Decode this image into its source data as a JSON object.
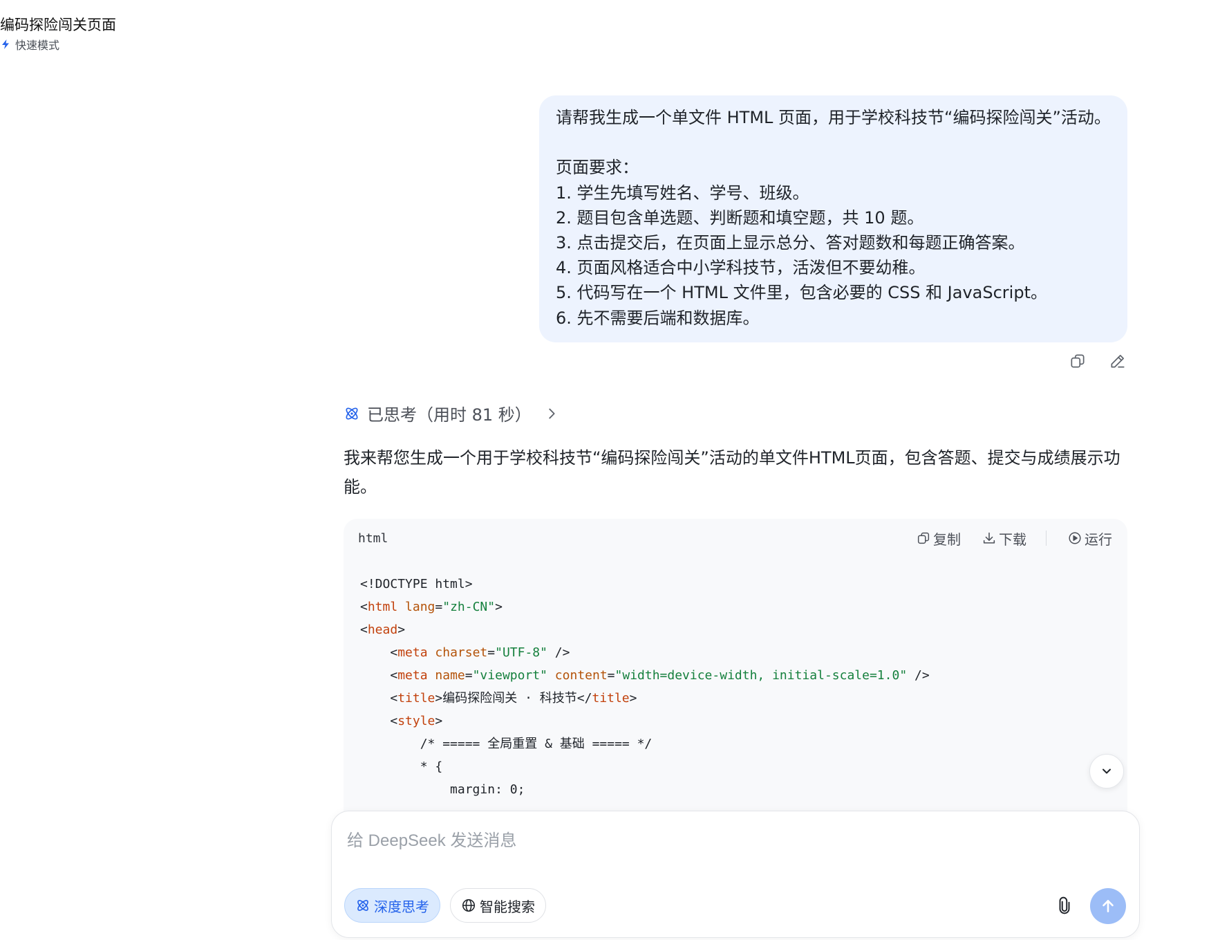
{
  "conversation": {
    "title": "编码探险闯关页面",
    "mode_label": "快速模式"
  },
  "user_message": {
    "lines": [
      "请帮我生成一个单文件 HTML 页面，用于学校科技节“编码探险闯关”活动。",
      "",
      "页面要求：",
      "1. 学生先填写姓名、学号、班级。",
      "2. 题目包含单选题、判断题和填空题，共 10 题。",
      "3. 点击提交后，在页面上显示总分、答对题数和每题正确答案。",
      "4. 页面风格适合中小学科技节，活泼但不要幼稚。",
      "5. 代码写在一个 HTML 文件里，包含必要的 CSS 和 JavaScript。",
      "6. 先不需要后端和数据库。"
    ]
  },
  "icons": {
    "copy": "copy-icon",
    "edit": "edit-icon",
    "thinking": "atom-icon",
    "expand": "chevron-right-icon",
    "download": "download-icon",
    "run": "play-circle-icon",
    "scroll": "chevron-down-icon",
    "globe": "globe-icon",
    "attach": "paperclip-icon",
    "send": "arrow-up-icon",
    "bolt": "bolt-icon"
  },
  "thinking": {
    "label": "已思考（用时 81 秒）"
  },
  "assistant": {
    "intro": "我来帮您生成一个用于学校科技节“编码探险闯关”活动的单文件HTML页面，包含答题、提交与成绩展示功能。"
  },
  "code_block": {
    "language": "html",
    "copy_label": "复制",
    "download_label": "下载",
    "run_label": "运行",
    "lines": {
      "l1": "<!DOCTYPE html>",
      "l2_open": "<",
      "l2_tag": "html",
      "l2_attr": " lang",
      "l2_eq": "=",
      "l2_val": "\"zh-CN\"",
      "l2_close": ">",
      "l3_open": "<",
      "l3_tag": "head",
      "l3_close": ">",
      "l4_indent": "    ",
      "l4_open": "<",
      "l4_tag": "meta",
      "l4_attr": " charset",
      "l4_eq": "=",
      "l4_val": "\"UTF-8\"",
      "l4_close": " />",
      "l5_indent": "    ",
      "l5_open": "<",
      "l5_tag": "meta",
      "l5_attr1": " name",
      "l5_eq1": "=",
      "l5_val1": "\"viewport\"",
      "l5_attr2": " content",
      "l5_eq2": "=",
      "l5_val2": "\"width=device-width, initial-scale=1.0\"",
      "l5_close": " />",
      "l6_indent": "    ",
      "l6_open": "<",
      "l6_tag": "title",
      "l6_close": ">",
      "l6_text": "编码探险闯关 · 科技节",
      "l6_end_open": "</",
      "l6_end_tag": "title",
      "l6_end_close": ">",
      "l7_indent": "    ",
      "l7_open": "<",
      "l7_tag": "style",
      "l7_close": ">",
      "l8": "        /* ===== 全局重置 & 基础 ===== */",
      "l9": "        * {",
      "l10": "            margin: 0;"
    }
  },
  "composer": {
    "placeholder": "给 DeepSeek 发送消息",
    "deep_think_label": "深度思考",
    "search_label": "智能搜索"
  },
  "colors": {
    "user_bubble": "#edf3fe",
    "accent": "#2563eb",
    "send_button": "#9cbdf7",
    "code_bg": "#f8f9fb",
    "code_tag": "#c2410c",
    "code_attr": "#b45309",
    "code_string": "#15803d"
  }
}
